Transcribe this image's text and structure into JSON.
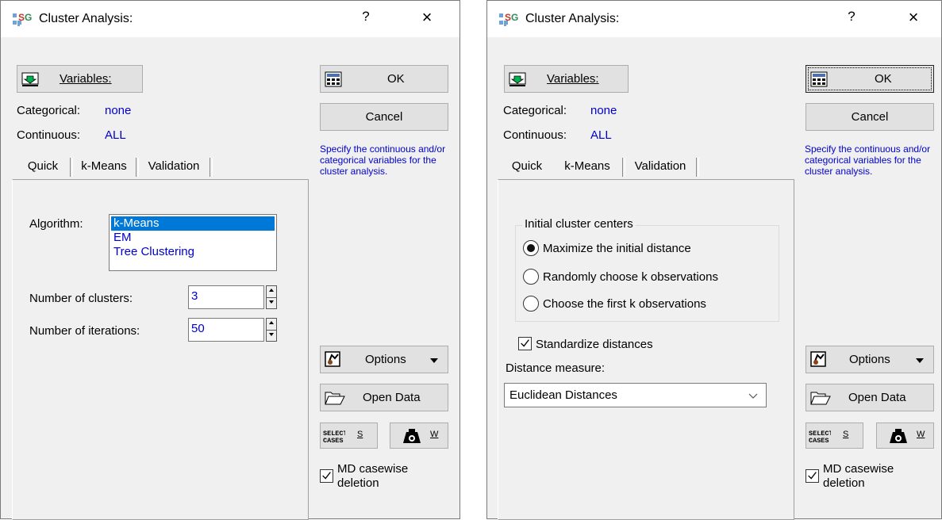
{
  "dialog_title": "Cluster Analysis:",
  "help_glyph": "?",
  "close_glyph": "×",
  "buttons": {
    "variables_label": "Variables:",
    "ok": "OK",
    "cancel": "Cancel",
    "options": "Options",
    "open_data": "Open Data",
    "select_cases_icon_text": "SELECT CASES",
    "select_cases_key": "S",
    "weight_key": "W"
  },
  "fields": {
    "categorical_label": "Categorical:",
    "categorical_value": "none",
    "continuous_label": "Continuous:",
    "continuous_value": "ALL"
  },
  "hint_text": "Specify the continuous and/or categorical variables for the cluster analysis.",
  "tabs": [
    "Quick",
    "k-Means",
    "Validation"
  ],
  "quick_tab": {
    "algorithm_label": "Algorithm:",
    "algorithms": [
      "k-Means",
      "EM",
      "Tree Clustering"
    ],
    "selected_algorithm": "k-Means",
    "clusters_label": "Number of clusters:",
    "clusters_value": "3",
    "iterations_label": "Number of iterations:",
    "iterations_value": "50"
  },
  "kmeans_tab": {
    "group_title": "Initial cluster centers",
    "options": [
      "Maximize the initial distance",
      "Randomly choose k observations",
      "Choose the first k observations"
    ],
    "selected_option": "Maximize the initial distance",
    "standardize_label": "Standardize distances",
    "standardize_checked": true,
    "distance_label": "Distance measure:",
    "distance_value": "Euclidean Distances"
  },
  "md_casewise": {
    "label_line1": "MD casewise",
    "label_line2": "deletion",
    "checked": true
  },
  "colors": {
    "link_blue": "#0000cc",
    "selection_blue": "#0078d7",
    "dialog_bg": "#f0f0f0"
  }
}
